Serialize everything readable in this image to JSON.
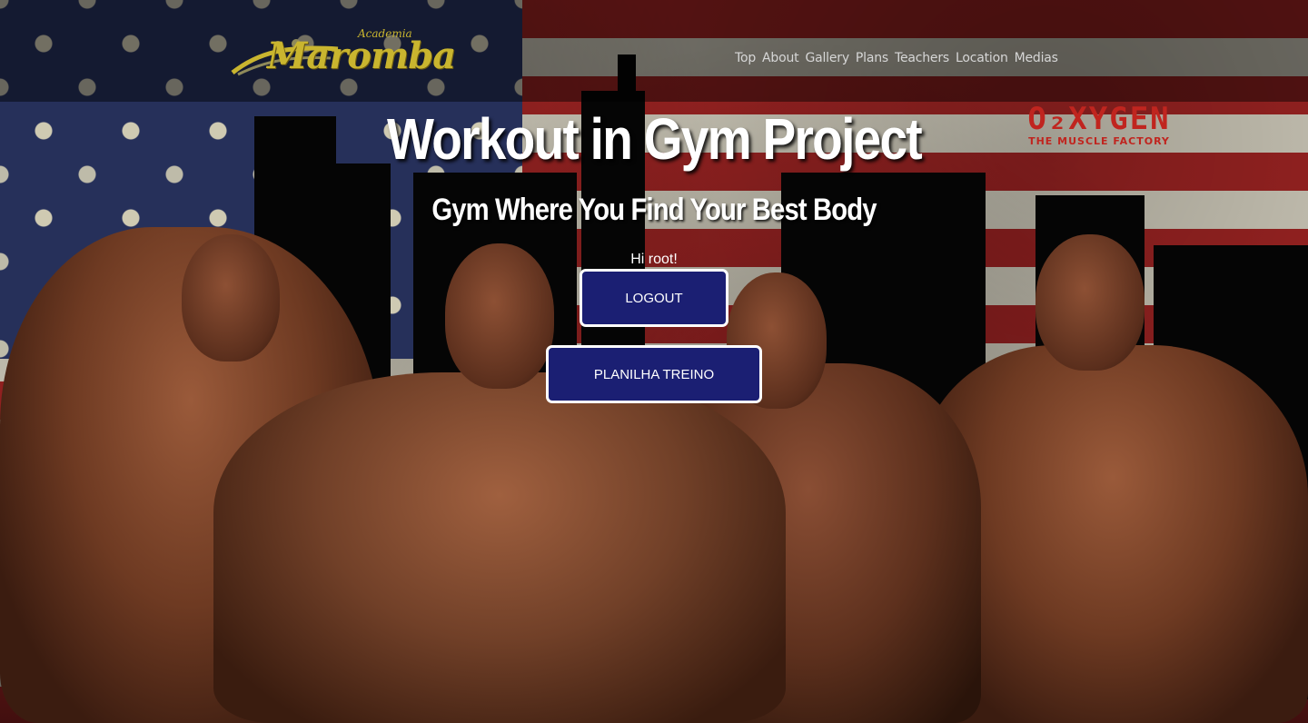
{
  "header": {
    "logo": {
      "brand": "aromba",
      "script": "Academia",
      "initial": "M"
    },
    "nav": [
      "Top",
      "About",
      "Gallery",
      "Plans",
      "Teachers",
      "Location",
      "Medias"
    ]
  },
  "sponsor": {
    "title": "O₂XYGEN",
    "subtitle": "THE MUSCLE FACTORY"
  },
  "hero": {
    "title": "Workout in Gym Project",
    "subtitle": "Gym Where You Find Your Best Body",
    "greeting": "Hi root!",
    "logout_label": "LOGOUT",
    "planilha_label": "PLANILHA TREINO"
  },
  "colors": {
    "button_bg": "#1b1f73",
    "logo_gold": "#c9b52f",
    "flag_red": "#b4201f",
    "flag_blue": "#26305a"
  }
}
